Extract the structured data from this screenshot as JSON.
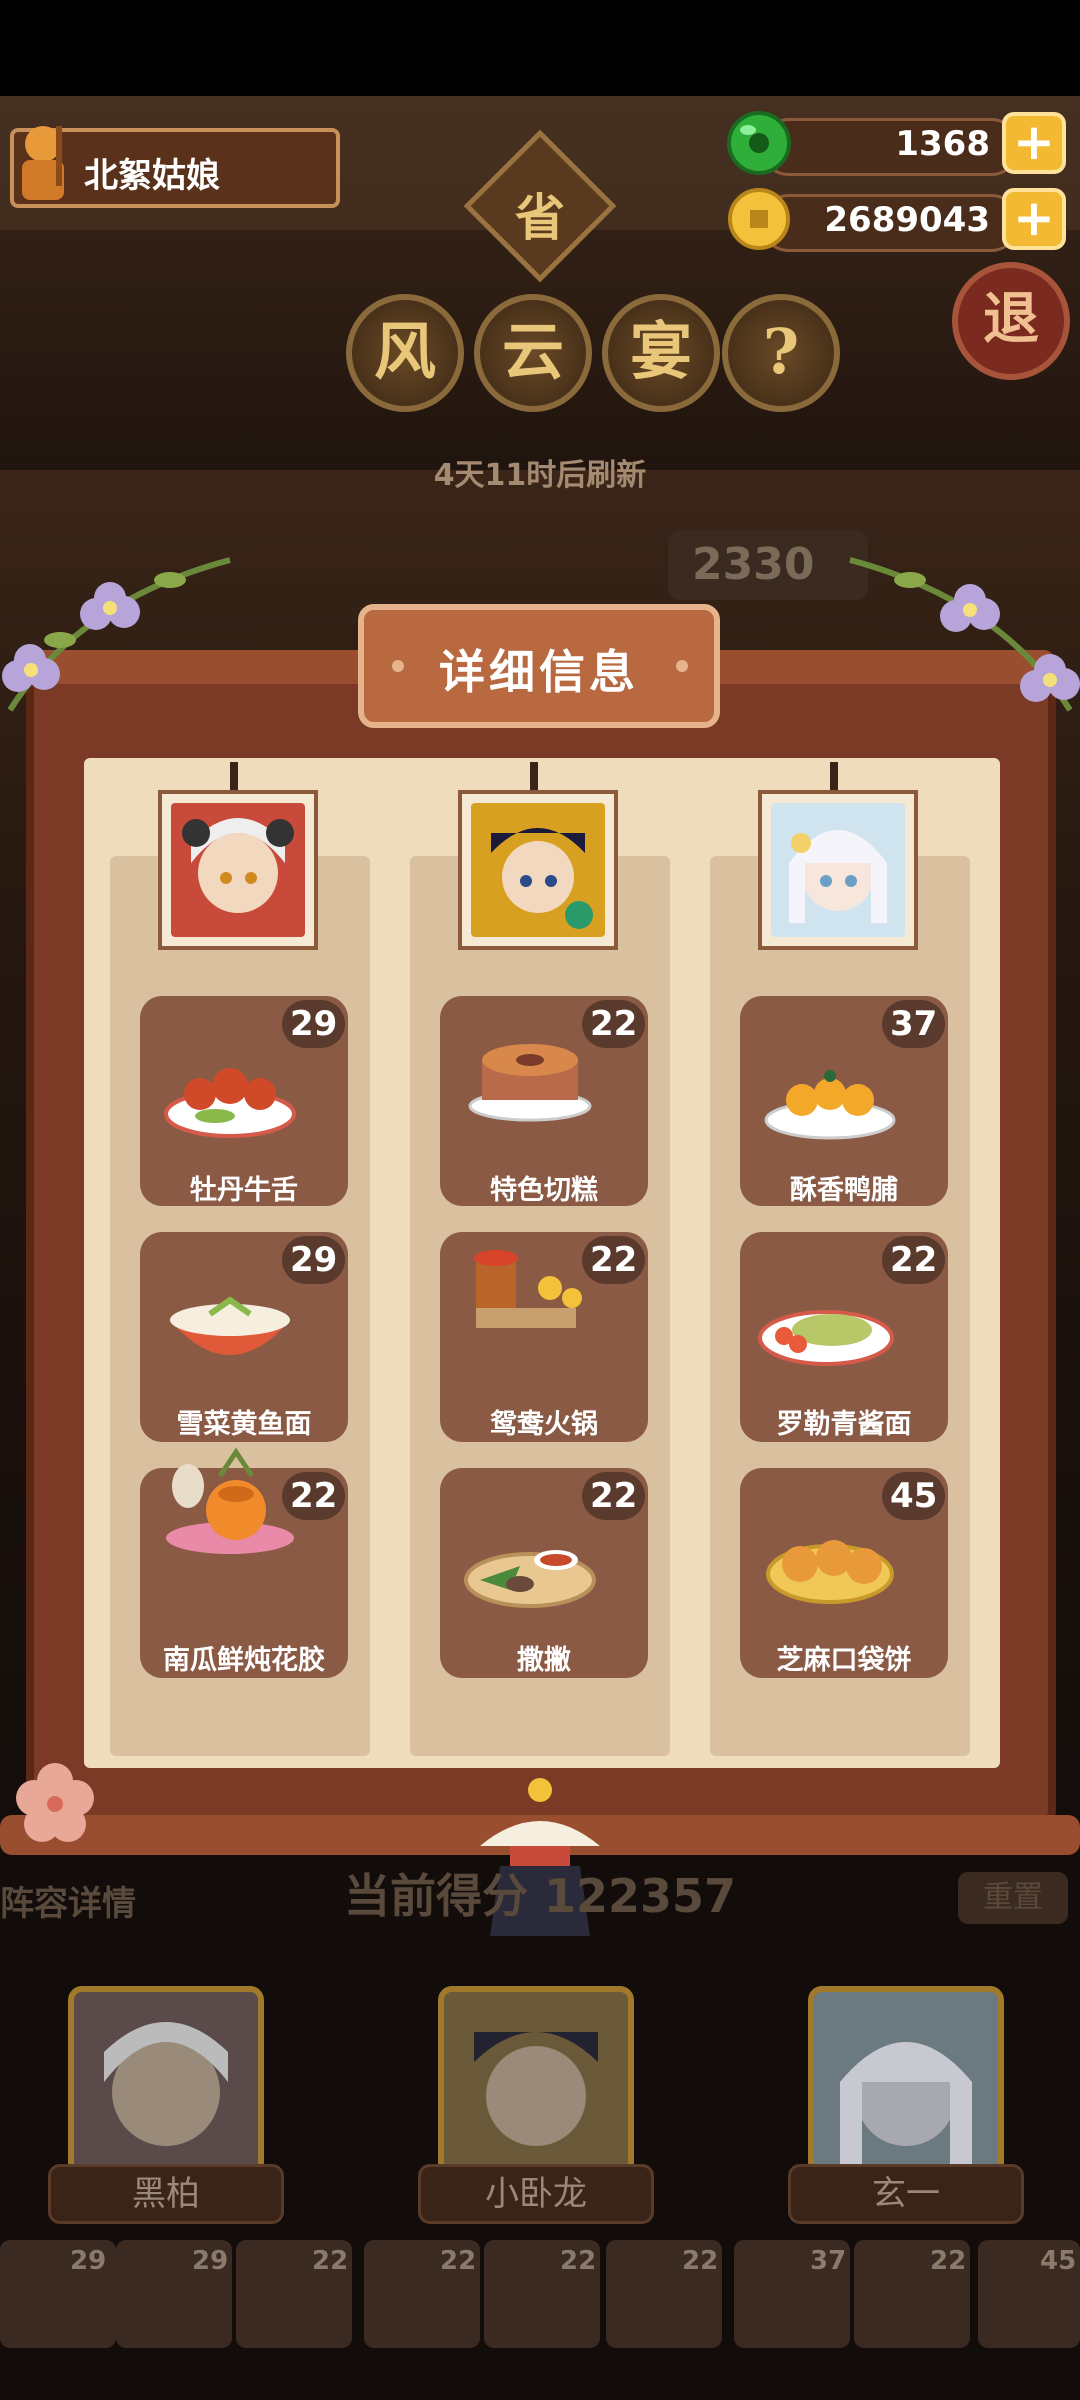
{
  "player": {
    "name": "北絮姑娘"
  },
  "currency": {
    "jade": {
      "icon": "jade-coin-icon",
      "value": "1368"
    },
    "gold": {
      "icon": "gold-coin-icon",
      "value": "2689043"
    },
    "plus_label": "+"
  },
  "title": {
    "badge": "省",
    "chars": [
      "风",
      "云",
      "宴"
    ],
    "help": "?"
  },
  "exit_label": "退",
  "refresh_text": "4天11时后刷新",
  "top_score_partial": "2330",
  "popup": {
    "title": "详细信息",
    "columns": [
      {
        "character_icon": "character-heibai-portrait",
        "dishes": [
          {
            "name": "牡丹牛舌",
            "count": "29",
            "icon": "peony-beef-tongue-icon"
          },
          {
            "name": "雪菜黄鱼面",
            "count": "29",
            "icon": "snow-veg-fish-noodle-icon"
          },
          {
            "name": "南瓜鲜炖花胶",
            "count": "22",
            "icon": "pumpkin-fish-maw-icon"
          }
        ]
      },
      {
        "character_icon": "character-xiaowolong-portrait",
        "dishes": [
          {
            "name": "特色切糕",
            "count": "22",
            "icon": "special-cake-icon"
          },
          {
            "name": "鸳鸯火锅",
            "count": "22",
            "icon": "twin-hotpot-icon"
          },
          {
            "name": "撒撇",
            "count": "22",
            "icon": "sapie-icon"
          }
        ]
      },
      {
        "character_icon": "character-xuanyi-portrait",
        "dishes": [
          {
            "name": "酥香鸭脯",
            "count": "37",
            "icon": "crispy-duck-icon"
          },
          {
            "name": "罗勒青酱面",
            "count": "22",
            "icon": "basil-pesto-noodle-icon"
          },
          {
            "name": "芝麻口袋饼",
            "count": "45",
            "icon": "sesame-pocket-pie-icon"
          }
        ]
      }
    ]
  },
  "bottom": {
    "lineup_label": "阵容详情",
    "score_label": "当前得分",
    "score_value": "122357",
    "reset_label": "重置",
    "characters": [
      {
        "name": "黑柏"
      },
      {
        "name": "小卧龙"
      },
      {
        "name": "玄一"
      }
    ],
    "slots": [
      "29",
      "29",
      "22",
      "22",
      "22",
      "22",
      "37",
      "22",
      "45"
    ]
  },
  "colors": {
    "panel_wood": "#7a3a25",
    "panel_paper": "#efdcbc",
    "dish_card": "#8a5a45",
    "accent_gold": "#f3b933"
  }
}
